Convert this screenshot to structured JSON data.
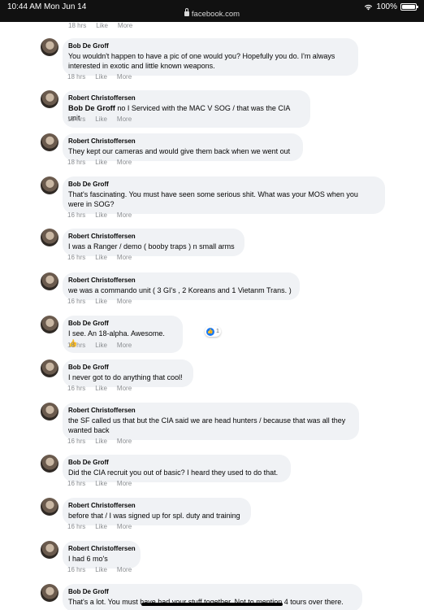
{
  "status": {
    "time": "10:44 AM  Mon Jun 14",
    "url": "facebook.com",
    "battery": "100%"
  },
  "top_actions": {
    "time": "18 hrs",
    "like": "Like",
    "more": "More"
  },
  "comments": [
    {
      "name": "Bob De Groff",
      "lines": [
        "You wouldn't happen to have a pic of one would you? Hopefully you do. I'm always",
        "interested in exotic and little known weapons."
      ],
      "time": "18 hrs",
      "like": "Like",
      "more": "More"
    },
    {
      "name": "Robert Christoffersen",
      "mention": "Bob De Groff",
      "lines": [
        " no I Serviced with the MAC V SOG / that was the CIA unit"
      ],
      "time": "18 hrs",
      "like": "Like",
      "more": "More"
    },
    {
      "name": "Robert Christoffersen",
      "lines": [
        "They kept our cameras and would give them back when we went out"
      ],
      "time": "18 hrs",
      "like": "Like",
      "more": "More"
    },
    {
      "name": "Bob De Groff",
      "lines": [
        "That's fascinating. You must have seen some serious shit. What was your MOS when you",
        "were in SOG?"
      ],
      "time": "16 hrs",
      "like": "Like",
      "more": "More"
    },
    {
      "name": "Robert Christoffersen",
      "lines": [
        "I was a Ranger / demo ( booby traps ) n small arms"
      ],
      "time": "16 hrs",
      "like": "Like",
      "more": "More"
    },
    {
      "name": "Robert Christoffersen",
      "lines": [
        "we was a commando unit ( 3 GI's , 2 Koreans and 1 Vietanm Trans. )"
      ],
      "time": "16 hrs",
      "like": "Like",
      "more": "More"
    },
    {
      "name": "Bob De Groff",
      "lines": [
        "I see. An 18-alpha. Awesome. 👍"
      ],
      "reaction_count": "1",
      "time": "16 hrs",
      "like": "Like",
      "more": "More"
    },
    {
      "name": "Bob De Groff",
      "lines": [
        "I never got to do anything that cool!"
      ],
      "time": "16 hrs",
      "like": "Like",
      "more": "More"
    },
    {
      "name": "Robert Christoffersen",
      "lines": [
        "the SF called us that but the CIA said we are head hunters / because that was all they",
        "wanted back"
      ],
      "time": "16 hrs",
      "like": "Like",
      "more": "More"
    },
    {
      "name": "Bob De Groff",
      "lines": [
        "Did the CIA recruit you out of basic? I heard they used to do that."
      ],
      "time": "16 hrs",
      "like": "Like",
      "more": "More"
    },
    {
      "name": "Robert Christoffersen",
      "lines": [
        "before that / I was signed up for spl. duty and training"
      ],
      "time": "16 hrs",
      "like": "Like",
      "more": "More"
    },
    {
      "name": "Robert Christoffersen",
      "lines": [
        "I had 6 mo's"
      ],
      "time": "16 hrs",
      "like": "Like",
      "more": "More"
    },
    {
      "name": "Bob De Groff",
      "lines": [
        "That's a lot. You must have had your stuff together. Not to mention 4 tours over there."
      ],
      "time": "",
      "like": "",
      "more": ""
    }
  ]
}
